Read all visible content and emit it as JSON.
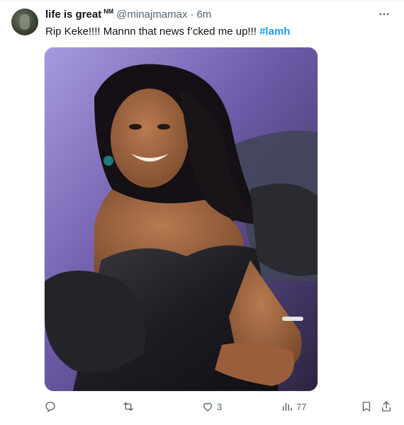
{
  "tweet": {
    "display_name": "life is great",
    "badge": "NM",
    "handle": "@minajmamax",
    "separator": "·",
    "time": "6m",
    "text_main": "Rip Keke!!!! Mannn that news f’cked me up!!! ",
    "hashtag": "#lamh",
    "media_alt": "Photo of a smiling woman with long wavy black hair wearing a black satin strapless dress with puffy sleeves, seated against a purple background"
  },
  "actions": {
    "reply_count": "",
    "retweet_count": "",
    "like_count": "3",
    "views_count": "77"
  },
  "icons": {
    "more": "more-horizontal-icon",
    "reply": "reply-icon",
    "retweet": "retweet-icon",
    "like": "heart-icon",
    "views": "views-icon",
    "bookmark": "bookmark-icon",
    "share": "share-icon"
  },
  "colors": {
    "accent": "#1d9bf0",
    "secondary_text": "#536471",
    "primary_text": "#0f1419"
  }
}
